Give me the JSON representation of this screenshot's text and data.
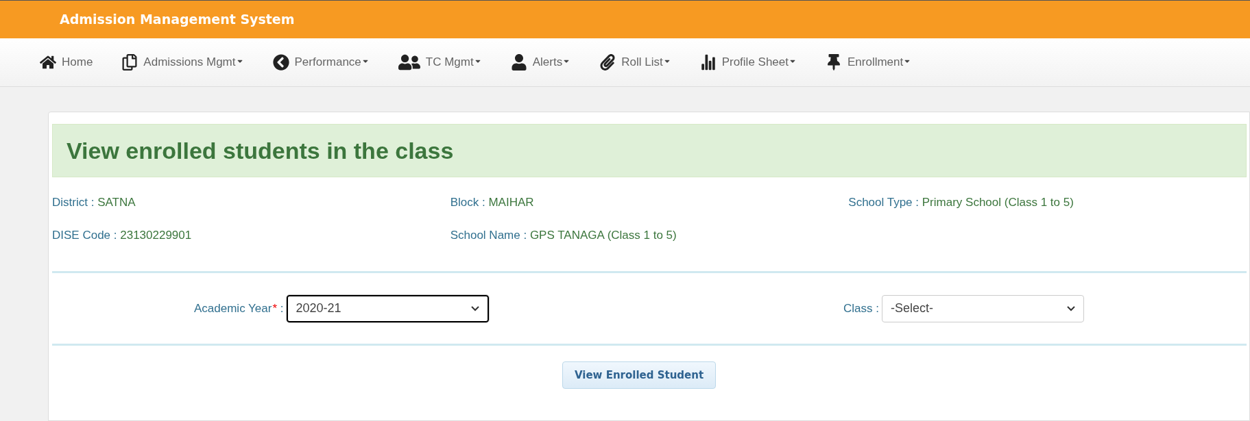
{
  "header": {
    "title": "Admission Management System"
  },
  "nav": [
    {
      "label": "Home",
      "kind": "home",
      "has_menu": false
    },
    {
      "label": "Admissions Mgmt",
      "kind": "docs",
      "has_menu": true
    },
    {
      "label": "Performance",
      "kind": "circle",
      "has_menu": true
    },
    {
      "label": "TC Mgmt",
      "kind": "users",
      "has_menu": true
    },
    {
      "label": "Alerts",
      "kind": "user",
      "has_menu": true
    },
    {
      "label": "Roll List",
      "kind": "clip",
      "has_menu": true
    },
    {
      "label": "Profile Sheet",
      "kind": "bars",
      "has_menu": true
    },
    {
      "label": "Enrollment",
      "kind": "pin",
      "has_menu": true
    }
  ],
  "page_title": "View enrolled students in the class",
  "info": [
    {
      "label": "District :",
      "value": "SATNA"
    },
    {
      "label": "Block :",
      "value": "MAIHAR"
    },
    {
      "label": "School Type :",
      "value": "Primary School (Class 1 to 5)"
    },
    {
      "label": "DISE Code :",
      "value": "23130229901"
    },
    {
      "label": "School Name :",
      "value": "GPS TANAGA (Class 1 to 5)"
    }
  ],
  "form": [
    {
      "label": "Academic Year",
      "required_mark": "*",
      "colon": ":",
      "value": "2020-21",
      "focused": true
    },
    {
      "label": "Class",
      "colon": ":",
      "value": "-Select-",
      "focused": false
    }
  ],
  "submit_button": "View Enrolled Student"
}
